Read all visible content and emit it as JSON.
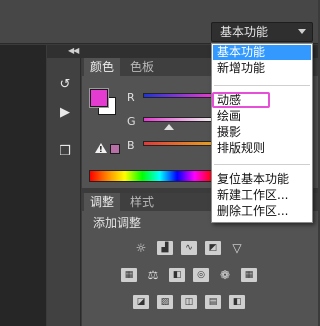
{
  "workspace": {
    "current": "基本功能",
    "menu_items": [
      {
        "label": "基本功能",
        "selected": true
      },
      {
        "label": "新增功能",
        "selected": false
      },
      {
        "label": "动感",
        "selected": false,
        "highlighted": true
      },
      {
        "label": "绘画",
        "selected": false
      },
      {
        "label": "摄影",
        "selected": false
      },
      {
        "label": "排版规则",
        "selected": false
      },
      {
        "label": "复位基本功能",
        "selected": false
      },
      {
        "label": "新建工作区...",
        "selected": false
      },
      {
        "label": "删除工作区...",
        "selected": false
      }
    ]
  },
  "color_panel": {
    "tabs": [
      "颜色",
      "色板"
    ],
    "active_tab": "颜色",
    "foreground_color": "#e43bd0",
    "background_color": "#ffffff",
    "channels": [
      "R",
      "G",
      "B"
    ],
    "out_of_gamut_swatch": "#b86fa8"
  },
  "adjust_panel": {
    "tabs": [
      "调整",
      "样式"
    ],
    "active_tab": "调整",
    "title": "添加调整"
  },
  "toolstrip": {
    "icons": [
      "history-icon",
      "play-icon",
      "3d-icon"
    ]
  },
  "colors": {
    "menu_selected": "#3399ff",
    "highlight": "#e64fd8",
    "panel_bg": "#535353"
  }
}
